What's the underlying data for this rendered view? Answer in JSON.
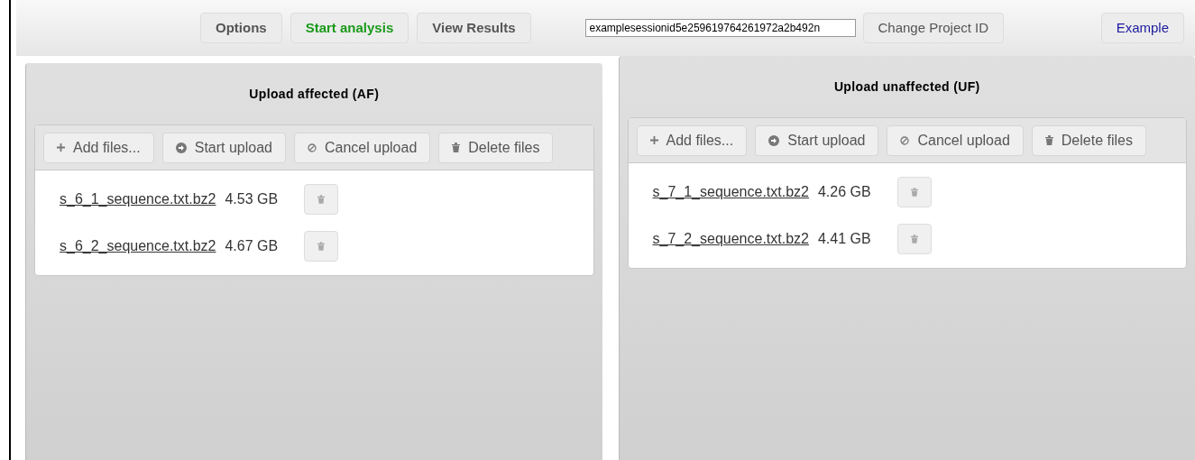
{
  "nav": [
    {
      "label": "Options",
      "selected": false
    },
    {
      "label": "Start analysis",
      "selected": true
    },
    {
      "label": "View Results",
      "selected": false
    }
  ],
  "project_id": {
    "value": "examplesessionid5e259619764261972a2b492n",
    "button": "Change Project ID"
  },
  "example_link": "Example",
  "panels": [
    {
      "title": "Upload affected (AF)",
      "toolbar": [
        "Add files...",
        "Start upload",
        "Cancel upload",
        "Delete files"
      ],
      "files": [
        {
          "name": "s_6_1_sequence.txt.bz2",
          "size": "4.53 GB"
        },
        {
          "name": "s_6_2_sequence.txt.bz2",
          "size": "4.67 GB"
        }
      ]
    },
    {
      "title": "Upload unaffected (UF)",
      "toolbar": [
        "Add files...",
        "Start upload",
        "Cancel upload",
        "Delete files"
      ],
      "files": [
        {
          "name": "s_7_1_sequence.txt.bz2",
          "size": "4.26 GB"
        },
        {
          "name": "s_7_2_sequence.txt.bz2",
          "size": "4.41 GB"
        }
      ]
    }
  ]
}
